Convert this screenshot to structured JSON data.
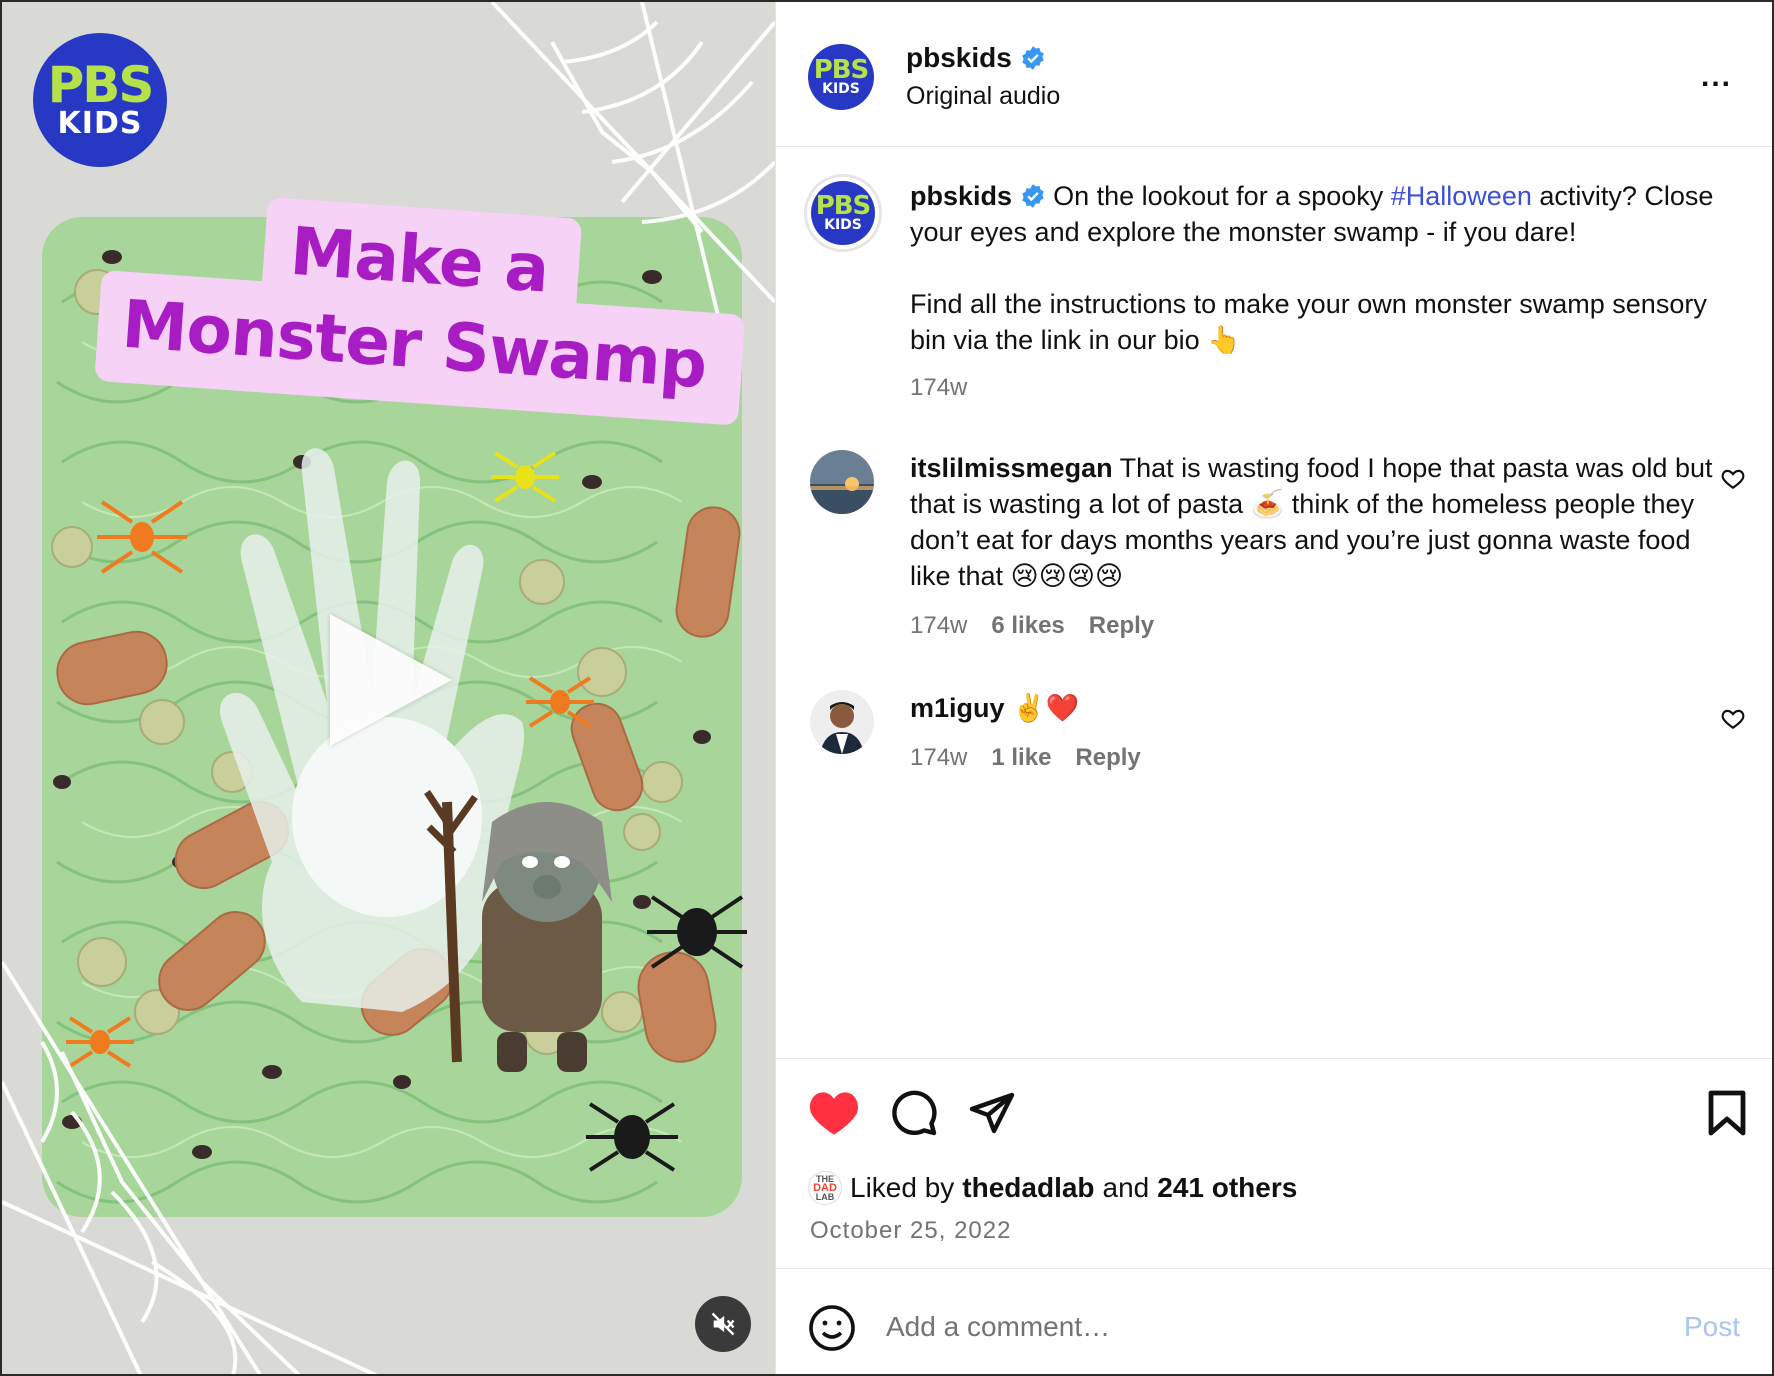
{
  "media": {
    "logo_line1": "PBS",
    "logo_line2": "KIDS",
    "title_line1": "Make a",
    "title_line2": "Monster Swamp"
  },
  "header": {
    "username": "pbskids",
    "subtitle": "Original audio",
    "avatar_line1": "PBS",
    "avatar_line2": "KIDS",
    "more_label": "..."
  },
  "caption": {
    "username": "pbskids",
    "text_before_tag": "On the lookout for a spooky ",
    "hashtag": "#Halloween",
    "text_after_tag": " activity? Close your eyes and explore the monster swamp - if you dare!",
    "paragraph2": "Find all the instructions to make your own monster swamp sensory bin via the link in our bio 👆",
    "age": "174w"
  },
  "comments": [
    {
      "username": "itslilmissmegan",
      "text": "That is wasting food I hope that pasta was old but that is wasting a lot of pasta 🍝 think of the homeless people they don’t eat for days months years and you’re just gonna waste food like that 😢😢😢😢",
      "age": "174w",
      "likes": "6 likes",
      "reply": "Reply"
    },
    {
      "username": "m1iguy",
      "text": "✌️❤️",
      "age": "174w",
      "likes": "1 like",
      "reply": "Reply"
    }
  ],
  "likes": {
    "prefix": "Liked by",
    "liker": "thedadlab",
    "joiner": "and",
    "others": "241 others",
    "avatar_line1": "THE",
    "avatar_line2": "DAD",
    "avatar_line3": "LAB"
  },
  "date": "October 25, 2022",
  "comment_box": {
    "placeholder": "Add a comment…",
    "post_label": "Post"
  },
  "colors": {
    "like_red": "#ff3040",
    "link_blue": "#3b4fd8",
    "verified_blue": "#3897f0",
    "pbs_blue": "#2638c4",
    "post_disabled": "#a9c4f5"
  }
}
